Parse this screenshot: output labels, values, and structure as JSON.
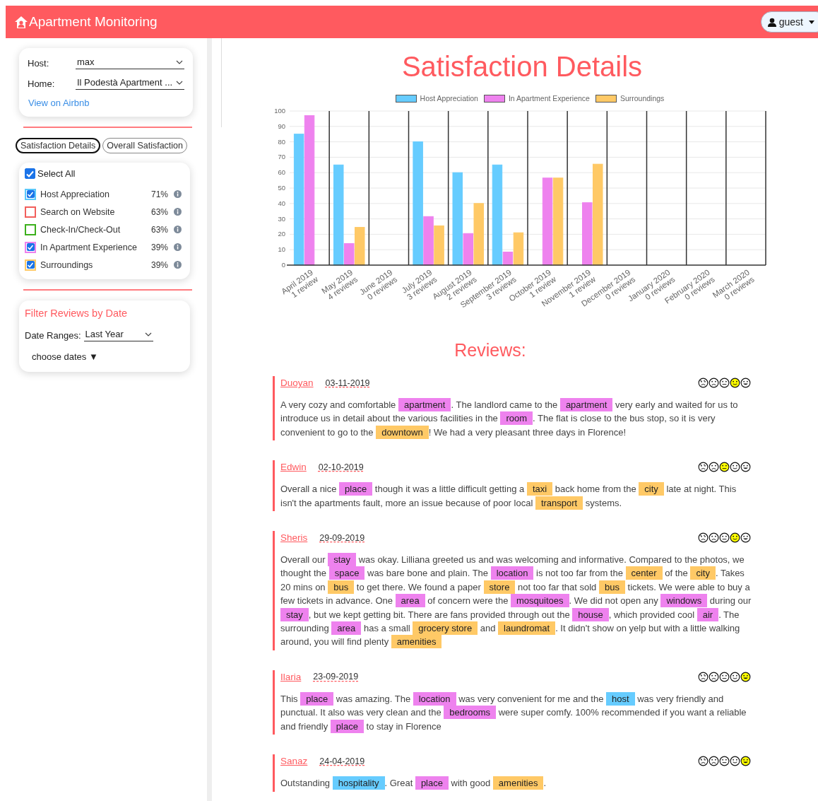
{
  "header": {
    "title": "Apartment Monitoring",
    "user_menu": {
      "label": "guest"
    }
  },
  "sidebar": {
    "selectors": [
      {
        "label": "Host:",
        "value": "max"
      },
      {
        "label": "Home:",
        "value": "Il Podestà Apartment ..."
      }
    ],
    "airbnb_link": "View on Airbnb",
    "view_buttons": [
      {
        "label": "Satisfaction Details",
        "selected": true
      },
      {
        "label": "Overall Satisfaction",
        "selected": false
      }
    ],
    "select_all": {
      "label": "Select All",
      "checked": true
    },
    "categories": [
      {
        "label": "Host Appreciation",
        "percent": "71%",
        "checked": true,
        "color": "#5ac8fa"
      },
      {
        "label": "Search on Website",
        "percent": "63%",
        "checked": false,
        "color": "#f25f5c"
      },
      {
        "label": "Check-In/Check-Out",
        "percent": "63%",
        "checked": false,
        "color": "#3cb01c"
      },
      {
        "label": "In Apartment Experience",
        "percent": "39%",
        "checked": true,
        "color": "#ee82ee"
      },
      {
        "label": "Surroundings",
        "percent": "39%",
        "checked": true,
        "color": "#ffc966"
      }
    ],
    "date_filter": {
      "title": "Filter Reviews by Date",
      "label": "Date Ranges:",
      "value": "Last Year",
      "choose": "choose dates ▼"
    }
  },
  "main": {
    "title": "Satisfaction Details",
    "chart_data": {
      "type": "bar",
      "categories": [
        "April 2019\n1 review",
        "May 2019\n4 reviews",
        "June 2019\n0 reviews",
        "July 2019\n3 reviews",
        "August 2019\n2 reviews",
        "September 2019\n3 reviews",
        "October 2019\n1 review",
        "November 2019\n1 review",
        "December 2019\n0 reviews",
        "January 2020\n0 reviews",
        "February 2020\n0 reviews",
        "March 2020\n0 reviews"
      ],
      "series": [
        {
          "name": "Host Appreciation",
          "color": "#66ccff",
          "values": [
            85,
            65,
            null,
            80,
            60,
            65,
            null,
            null,
            null,
            null,
            null,
            null
          ]
        },
        {
          "name": "In Apartment Experience",
          "color": "#ee82ee",
          "values": [
            97,
            14,
            null,
            31.5,
            20.5,
            8.5,
            56.5,
            40.5,
            null,
            null,
            null,
            null
          ]
        },
        {
          "name": "Surroundings",
          "color": "#ffc966",
          "values": [
            null,
            24.5,
            null,
            25.5,
            40,
            21,
            56.5,
            65.5,
            null,
            null,
            null,
            null
          ]
        }
      ],
      "grid": true,
      "legend": "top",
      "ylim": [
        0,
        100
      ],
      "yticks": [
        0,
        10,
        20,
        30,
        40,
        50,
        60,
        70,
        80,
        90,
        100
      ]
    },
    "reviews_title": "Reviews:",
    "reviews": [
      {
        "author": "Duoyan",
        "date": "03-11-2019",
        "faces": [
          {
            "kind": "angry",
            "selected": false
          },
          {
            "kind": "sad",
            "selected": false
          },
          {
            "kind": "neutral",
            "selected": false
          },
          {
            "kind": "smile",
            "selected": true
          },
          {
            "kind": "grin",
            "selected": false
          }
        ],
        "parts": [
          {
            "kind": "plain",
            "text": "A very cozy and comfortable "
          },
          {
            "kind": "apartment",
            "text": "apartment"
          },
          {
            "kind": "plain",
            "text": ". The landlord came to the "
          },
          {
            "kind": "apartment",
            "text": "apartment"
          },
          {
            "kind": "plain",
            "text": " very early and waited for us to introduce us in detail about the various facilities in the "
          },
          {
            "kind": "apartment",
            "text": "room"
          },
          {
            "kind": "plain",
            "text": ". The flat is close to the bus stop, so it is very convenient to go to the "
          },
          {
            "kind": "surroundings",
            "text": "downtown"
          },
          {
            "kind": "plain",
            "text": "! We had a very pleasant three days in Florence!"
          }
        ]
      },
      {
        "author": "Edwin",
        "date": "02-10-2019",
        "faces": [
          {
            "kind": "angry",
            "selected": false
          },
          {
            "kind": "sad",
            "selected": false
          },
          {
            "kind": "neutral",
            "selected": true
          },
          {
            "kind": "smile",
            "selected": false
          },
          {
            "kind": "grin",
            "selected": false
          }
        ],
        "parts": [
          {
            "kind": "plain",
            "text": "Overall a nice "
          },
          {
            "kind": "apartment",
            "text": "place"
          },
          {
            "kind": "plain",
            "text": " though it was a little difficult getting a "
          },
          {
            "kind": "surroundings",
            "text": "taxi"
          },
          {
            "kind": "plain",
            "text": " back home from the "
          },
          {
            "kind": "surroundings",
            "text": "city"
          },
          {
            "kind": "plain",
            "text": " late at night. This isn't the apartments fault, more an issue because of poor local "
          },
          {
            "kind": "surroundings",
            "text": "transport"
          },
          {
            "kind": "plain",
            "text": " systems."
          }
        ]
      },
      {
        "author": "Sheris",
        "date": "29-09-2019",
        "faces": [
          {
            "kind": "angry",
            "selected": false
          },
          {
            "kind": "sad",
            "selected": false
          },
          {
            "kind": "neutral",
            "selected": false
          },
          {
            "kind": "smile",
            "selected": true
          },
          {
            "kind": "grin",
            "selected": false
          }
        ],
        "parts": [
          {
            "kind": "plain",
            "text": "Overall our "
          },
          {
            "kind": "apartment",
            "text": "stay"
          },
          {
            "kind": "plain",
            "text": " was okay. Lilliana greeted us and was welcoming and informative. Compared to the photos, we thought the "
          },
          {
            "kind": "apartment",
            "text": "space"
          },
          {
            "kind": "plain",
            "text": " was bare bone and plain. The "
          },
          {
            "kind": "apartment",
            "text": "location"
          },
          {
            "kind": "plain",
            "text": " is not too far from the "
          },
          {
            "kind": "surroundings",
            "text": "center"
          },
          {
            "kind": "plain",
            "text": " of the "
          },
          {
            "kind": "surroundings",
            "text": "city"
          },
          {
            "kind": "plain",
            "text": ". Takes 20 mins on "
          },
          {
            "kind": "surroundings",
            "text": "bus"
          },
          {
            "kind": "plain",
            "text": " to get there. We found a paper "
          },
          {
            "kind": "surroundings",
            "text": "store"
          },
          {
            "kind": "plain",
            "text": " not too far that sold "
          },
          {
            "kind": "surroundings",
            "text": "bus"
          },
          {
            "kind": "plain",
            "text": " tickets. We were able to buy a few tickets in advance. One "
          },
          {
            "kind": "apartment",
            "text": "area"
          },
          {
            "kind": "plain",
            "text": " of concern were the "
          },
          {
            "kind": "apartment",
            "text": "mosquitoes"
          },
          {
            "kind": "plain",
            "text": ". We did not open any "
          },
          {
            "kind": "apartment",
            "text": "windows"
          },
          {
            "kind": "plain",
            "text": " during our "
          },
          {
            "kind": "apartment",
            "text": "stay"
          },
          {
            "kind": "plain",
            "text": ", but we kept getting bit. There are fans provided through out the "
          },
          {
            "kind": "apartment",
            "text": "house"
          },
          {
            "kind": "plain",
            "text": ", which provided cool "
          },
          {
            "kind": "apartment",
            "text": "air"
          },
          {
            "kind": "plain",
            "text": ". The surrounding "
          },
          {
            "kind": "apartment",
            "text": "area"
          },
          {
            "kind": "plain",
            "text": " has a small "
          },
          {
            "kind": "surroundings",
            "text": "grocery store"
          },
          {
            "kind": "plain",
            "text": " and "
          },
          {
            "kind": "surroundings",
            "text": "laundromat"
          },
          {
            "kind": "plain",
            "text": ". It didn't show on yelp but with a little walking around, you will find plenty "
          },
          {
            "kind": "surroundings",
            "text": "amenities"
          }
        ]
      },
      {
        "author": "Ilaria",
        "date": "23-09-2019",
        "faces": [
          {
            "kind": "angry",
            "selected": false
          },
          {
            "kind": "sad",
            "selected": false
          },
          {
            "kind": "neutral",
            "selected": false
          },
          {
            "kind": "smile",
            "selected": false
          },
          {
            "kind": "grin",
            "selected": true
          }
        ],
        "parts": [
          {
            "kind": "plain",
            "text": "This "
          },
          {
            "kind": "apartment",
            "text": "place"
          },
          {
            "kind": "plain",
            "text": " was amazing. The "
          },
          {
            "kind": "apartment",
            "text": "location"
          },
          {
            "kind": "plain",
            "text": " was very convenient for me and the "
          },
          {
            "kind": "host",
            "text": "host"
          },
          {
            "kind": "plain",
            "text": " was very friendly and punctual. It also was very clean and the "
          },
          {
            "kind": "apartment",
            "text": "bedrooms"
          },
          {
            "kind": "plain",
            "text": " were super comfy. 100% recommended if you want a reliable and friendly "
          },
          {
            "kind": "apartment",
            "text": "place"
          },
          {
            "kind": "plain",
            "text": " to stay in Florence"
          }
        ]
      },
      {
        "author": "Sanaz",
        "date": "24-04-2019",
        "faces": [
          {
            "kind": "angry",
            "selected": false
          },
          {
            "kind": "sad",
            "selected": false
          },
          {
            "kind": "neutral",
            "selected": false
          },
          {
            "kind": "smile",
            "selected": false
          },
          {
            "kind": "grin",
            "selected": true
          }
        ],
        "parts": [
          {
            "kind": "plain",
            "text": "Outstanding "
          },
          {
            "kind": "host",
            "text": "hospitality"
          },
          {
            "kind": "plain",
            "text": ". Great "
          },
          {
            "kind": "apartment",
            "text": "place"
          },
          {
            "kind": "plain",
            "text": " with good "
          },
          {
            "kind": "surroundings",
            "text": "amenities"
          },
          {
            "kind": "plain",
            "text": "."
          }
        ]
      }
    ]
  }
}
